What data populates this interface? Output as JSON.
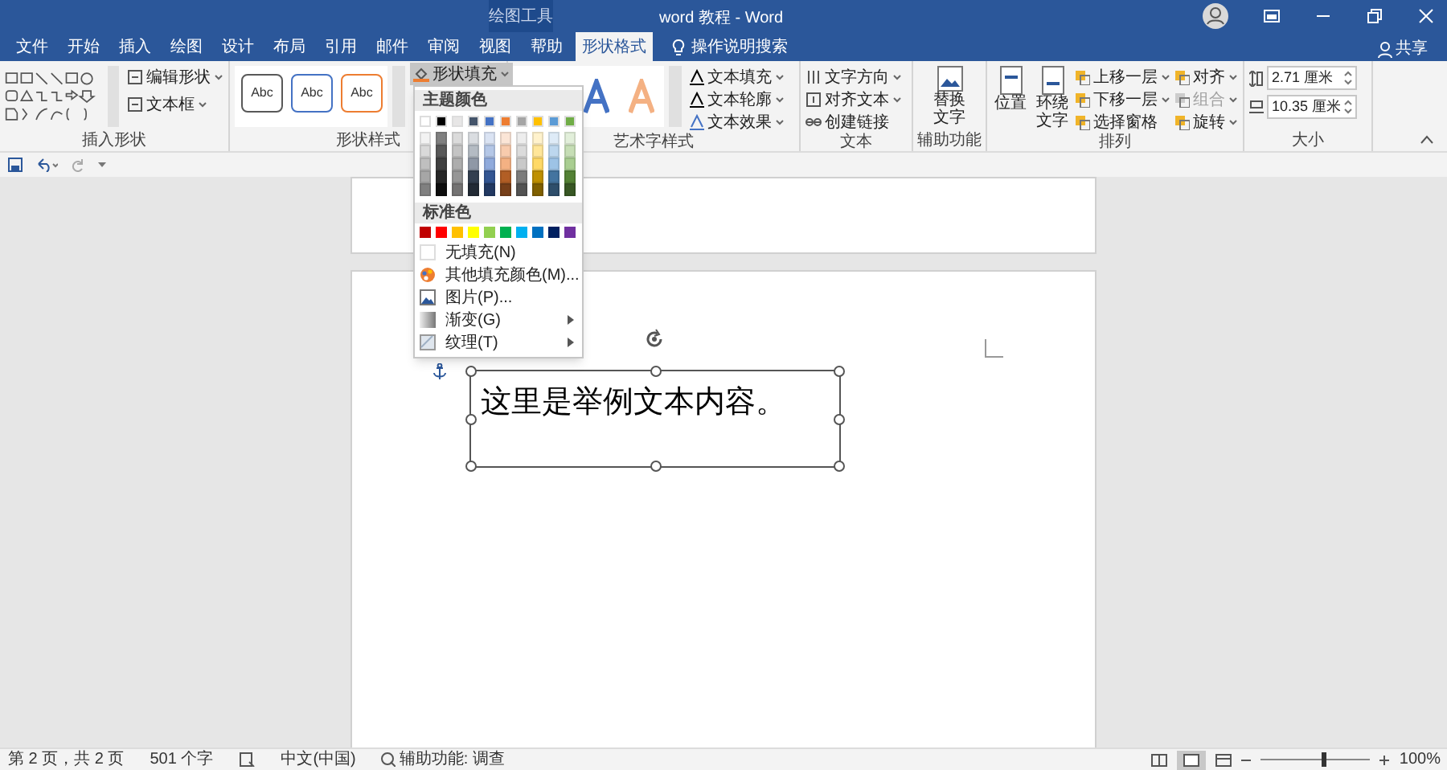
{
  "title_bar": {
    "context_label": "绘图工具",
    "title": "word 教程 - Word",
    "share": "共享"
  },
  "tabs": [
    {
      "label": "文件",
      "selected": false
    },
    {
      "label": "开始",
      "selected": false
    },
    {
      "label": "插入",
      "selected": false
    },
    {
      "label": "绘图",
      "selected": false
    },
    {
      "label": "设计",
      "selected": false
    },
    {
      "label": "布局",
      "selected": false
    },
    {
      "label": "引用",
      "selected": false
    },
    {
      "label": "邮件",
      "selected": false
    },
    {
      "label": "审阅",
      "selected": false
    },
    {
      "label": "视图",
      "selected": false
    },
    {
      "label": "帮助",
      "selected": false
    },
    {
      "label": "形状格式",
      "selected": true
    }
  ],
  "search": "操作说明搜索",
  "insert_shapes": {
    "commands": [
      "编辑形状",
      "文本框"
    ],
    "label": "插入形状"
  },
  "shape_styles": {
    "presets": [
      {
        "text": "Abc",
        "color": "#595959"
      },
      {
        "text": "Abc",
        "color": "#4472c4"
      },
      {
        "text": "Abc",
        "color": "#ed7d31"
      }
    ],
    "fill_button": {
      "label": "形状填充",
      "expanded": true
    },
    "label": "形状样式"
  },
  "wordart_styles": {
    "commands": [
      "文本填充",
      "文本轮廓",
      "文本效果"
    ],
    "label": "艺术字样式"
  },
  "text_group": {
    "commands": [
      "文字方向",
      "对齐文本",
      "创建链接"
    ],
    "label": "文本"
  },
  "accessibility": {
    "command": "替换文字",
    "label": "辅助功能"
  },
  "arrange": {
    "large": [
      "位置",
      "环绕文字"
    ],
    "commands": [
      {
        "label": "上移一层",
        "disabled": false
      },
      {
        "label": "对齐",
        "disabled": false
      },
      {
        "label": "下移一层",
        "disabled": false
      },
      {
        "label": "组合",
        "disabled": true
      },
      {
        "label": "选择窗格",
        "disabled": false
      },
      {
        "label": "旋转",
        "disabled": false
      }
    ],
    "label": "排列"
  },
  "size": {
    "height": "2.71 厘米",
    "width": "10.35 厘米",
    "label": "大小"
  },
  "fill_menu": {
    "theme_title": "主题颜色",
    "theme_colors": [
      {
        "color": "#ffffff"
      },
      {
        "color": "#000000"
      },
      {
        "color": "#e7e6e6"
      },
      {
        "color": "#44546a"
      },
      {
        "color": "#4472c4"
      },
      {
        "color": "#ed7d31"
      },
      {
        "color": "#a5a5a5"
      },
      {
        "color": "#ffc000"
      },
      {
        "color": "#5b9bd5"
      },
      {
        "color": "#70ad47"
      }
    ],
    "standard_title": "标准色",
    "standard_colors": [
      {
        "color": "#c00000"
      },
      {
        "color": "#ff0000"
      },
      {
        "color": "#ffc000"
      },
      {
        "color": "#ffff00"
      },
      {
        "color": "#92d050"
      },
      {
        "color": "#00b050"
      },
      {
        "color": "#00b0f0"
      },
      {
        "color": "#0070c0"
      },
      {
        "color": "#002060"
      },
      {
        "color": "#7030a0"
      }
    ],
    "items": [
      {
        "label": "无填充(N)",
        "kind": "none",
        "submenu": false
      },
      {
        "label": "其他填充颜色(M)...",
        "kind": "palette",
        "submenu": false
      },
      {
        "label": "图片(P)...",
        "kind": "picture",
        "submenu": false
      },
      {
        "label": "渐变(G)",
        "kind": "gradient",
        "submenu": true
      },
      {
        "label": "纹理(T)",
        "kind": "texture",
        "submenu": true
      }
    ]
  },
  "document": {
    "text_box": "这里是举例文本内容。"
  },
  "status_bar": {
    "page": "第 2 页，共 2 页",
    "words": "501 个字",
    "language": "中文(中国)",
    "accessibility": "辅助功能: 调查",
    "zoom": "100%",
    "zoom_level": {
      "level": 0.55
    }
  }
}
